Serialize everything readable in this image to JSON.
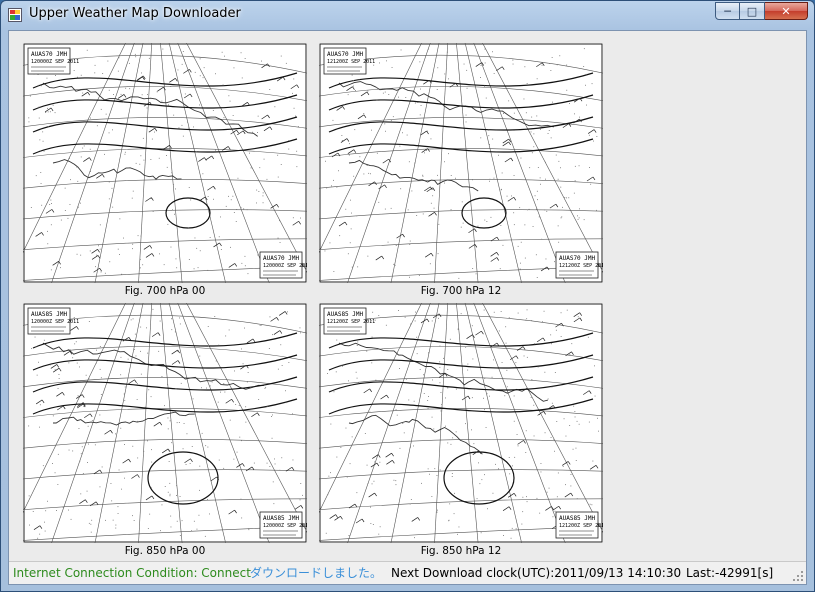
{
  "window": {
    "title": "Upper Weather Map Downloader",
    "controls": {
      "minimize": "─",
      "maximize": "□",
      "close": "✕"
    }
  },
  "maps": [
    {
      "caption": "Fig. 700 hPa 00",
      "header": "AUAS70 JMH",
      "subheader": "120000Z SEP 2011"
    },
    {
      "caption": "Fig. 700 hPa 12",
      "header": "AUAS70 JMH",
      "subheader": "121200Z SEP 2011"
    },
    {
      "caption": "Fig. 850 hPa 00",
      "header": "AUAS85 JMH",
      "subheader": "120000Z SEP 2011"
    },
    {
      "caption": "Fig. 850 hPa 12",
      "header": "AUAS85 JMH",
      "subheader": "121200Z SEP 2011"
    }
  ],
  "status": {
    "connection": "Internet Connection Condition: Connect",
    "message": "ダウンロードしました。",
    "next_download": "Next Download clock(UTC):2011/09/13 14:10:30",
    "last": "Last:-42991[s]",
    "colors": {
      "connection": "#2e8b1e",
      "message": "#3a8fd8"
    }
  }
}
